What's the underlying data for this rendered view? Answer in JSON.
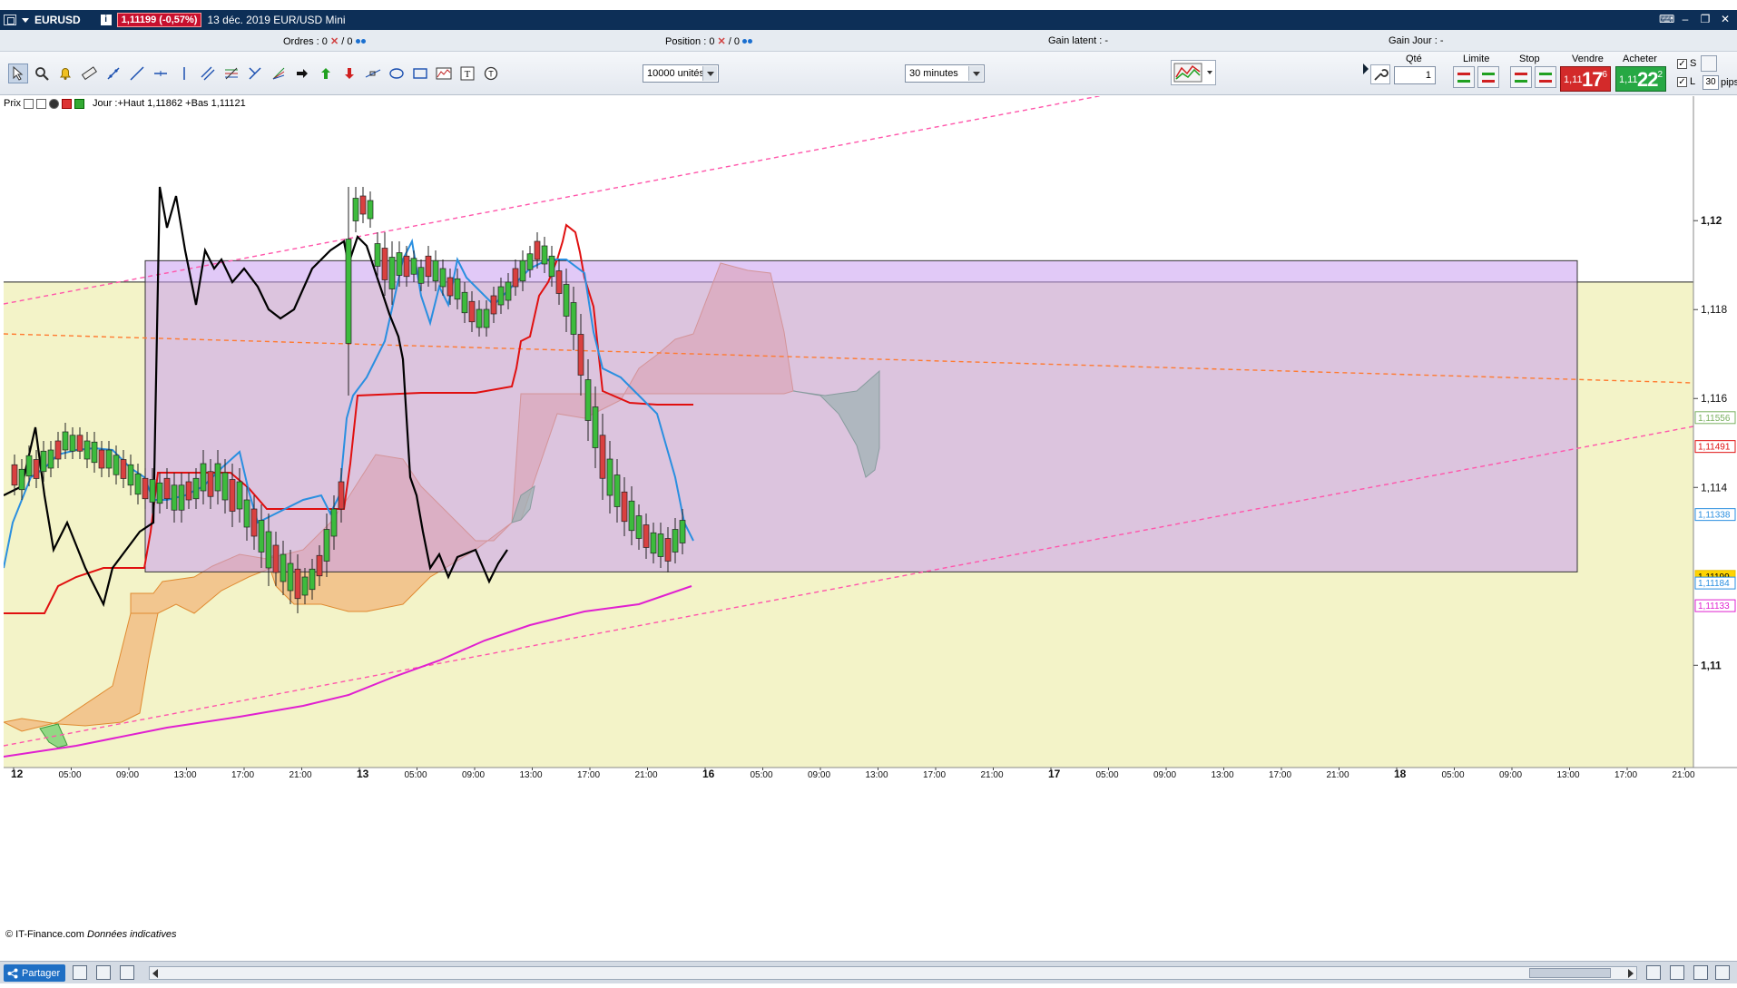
{
  "titlebar": {
    "symbol": "EURUSD",
    "price_badge": "1,11199 (-0,57%)",
    "description": "13 déc. 2019 EUR/USD Mini"
  },
  "infobar": {
    "orders_label": "Ordres :",
    "orders_value": "0",
    "orders_total": "/ 0",
    "position_label": "Position :",
    "position_value": "0",
    "position_total": "/ 0",
    "gain_latent_label": "Gain latent :",
    "gain_latent_value": "-",
    "gain_jour_label": "Gain Jour :",
    "gain_jour_value": "-"
  },
  "toolbar": {
    "units_select": "10000 unités",
    "timeframe_select": "30 minutes"
  },
  "order_panel": {
    "qty_label": "Qté",
    "qty_value": "1",
    "limit_label": "Limite",
    "stop_label": "Stop",
    "sell_label": "Vendre",
    "buy_label": "Acheter",
    "sell_price_small": "1,11",
    "sell_price_big": "17",
    "sell_price_sup": "6",
    "buy_price_small": "1,11",
    "buy_price_big": "22",
    "buy_price_sup": "2",
    "s_label": "S",
    "l_label": "L",
    "pips_value": "30",
    "pips_label": "pips"
  },
  "legend": {
    "prix_label": "Prix",
    "jour_text": "Jour :+Haut 1,11862 +Bas 1,11121"
  },
  "footer": {
    "copyright": "© IT-Finance.com",
    "note": "Données indicatives",
    "share_label": "Partager"
  },
  "colors": {
    "titlebar": "#0d2f57",
    "price_red": "#c8102e",
    "ichimoku_cloud_bear": "#f0a060",
    "ichimoku_cloud_bull": "#66cc66",
    "kijun_red": "#e01010",
    "tenkan_blue": "#2a8fe0",
    "chikou_black": "#000000",
    "sma_magenta": "#e020d0",
    "box_purple": "#c89cf0",
    "zone_yellow": "#f3f3c8"
  },
  "chart_data": {
    "type": "candlestick",
    "instrument": "EURUSD",
    "timeframe": "30 minutes",
    "ylim": [
      1.1077,
      1.1228
    ],
    "y_ticks": [
      {
        "value": 1.12,
        "label": "1,12"
      },
      {
        "value": 1.118,
        "label": "1,118"
      },
      {
        "value": 1.116,
        "label": "1,116"
      },
      {
        "value": 1.114,
        "label": "1,114"
      },
      {
        "value": 1.11,
        "label": "1,11"
      }
    ],
    "price_tags": [
      {
        "label": "1,11556",
        "value": 1.11556,
        "color": "#7ab060"
      },
      {
        "label": "1,11491",
        "value": 1.11491,
        "color": "#e01010"
      },
      {
        "label": "1,11338",
        "value": 1.11338,
        "color": "#2a8fe0"
      },
      {
        "label": "1,11199",
        "value": 1.11199,
        "color": "#e8c000"
      },
      {
        "label": "1,11184",
        "value": 1.11184,
        "color": "#2a8fe0"
      },
      {
        "label": "1,11133",
        "value": 1.11133,
        "color": "#e020d0"
      }
    ],
    "x_ticks": [
      {
        "label": "12",
        "major": true
      },
      {
        "label": "05:00"
      },
      {
        "label": "09:00"
      },
      {
        "label": "13:00"
      },
      {
        "label": "17:00"
      },
      {
        "label": "21:00"
      },
      {
        "label": "13",
        "major": true
      },
      {
        "label": "05:00"
      },
      {
        "label": "09:00"
      },
      {
        "label": "13:00"
      },
      {
        "label": "17:00"
      },
      {
        "label": "21:00"
      },
      {
        "label": "16",
        "major": true
      },
      {
        "label": "05:00"
      },
      {
        "label": "09:00"
      },
      {
        "label": "13:00"
      },
      {
        "label": "17:00"
      },
      {
        "label": "21:00"
      },
      {
        "label": "17",
        "major": true
      },
      {
        "label": "05:00"
      },
      {
        "label": "09:00"
      },
      {
        "label": "13:00"
      },
      {
        "label": "17:00"
      },
      {
        "label": "21:00"
      },
      {
        "label": "18",
        "major": true
      },
      {
        "label": "05:00"
      },
      {
        "label": "09:00"
      },
      {
        "label": "13:00"
      },
      {
        "label": "17:00"
      },
      {
        "label": "21:00"
      }
    ],
    "box": {
      "high": 1.1191,
      "low": 1.1121
    },
    "hline": 1.11862
  }
}
